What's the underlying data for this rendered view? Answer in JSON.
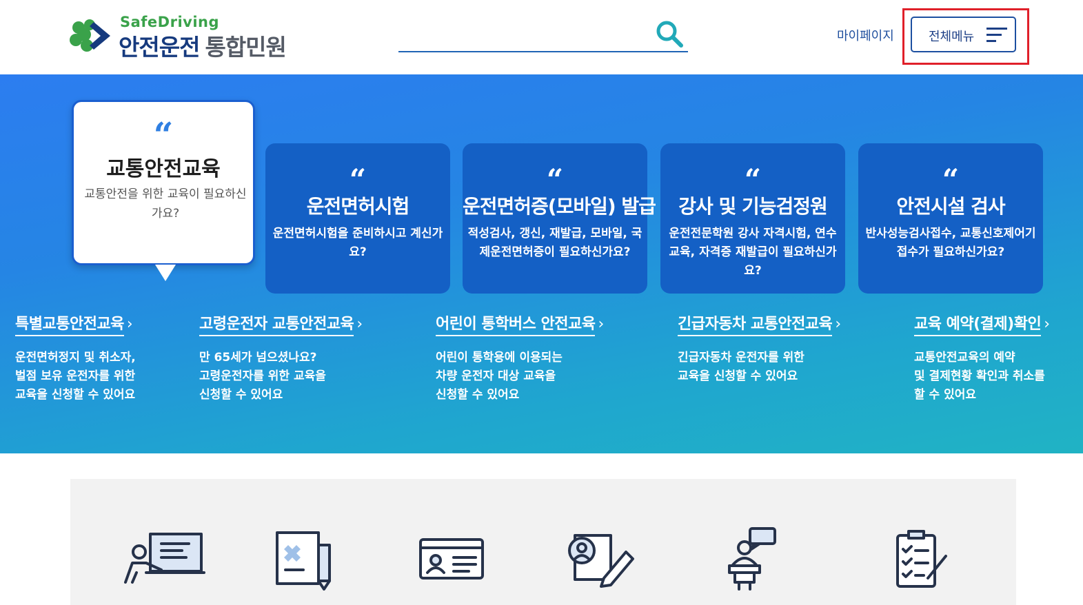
{
  "header": {
    "logo_en": "SafeDriving",
    "logo_ko_main": "안전운전",
    "logo_ko_sub": "통합민원",
    "search_placeholder": "",
    "mypage_label": "마이페이지",
    "menu_label": "전체메뉴"
  },
  "hero": {
    "featured": {
      "quote": "“",
      "title": "교통안전교육",
      "desc": "교통안전을 위한 교육이 필요하신가요?"
    },
    "cards": [
      {
        "quote": "“",
        "title": "운전면허시험",
        "desc": "운전면허시험을 준비하시고 계신가요?"
      },
      {
        "quote": "“",
        "title": "운전면허증(모바일) 발급",
        "desc": "적성검사, 갱신, 재발급, 모바일, 국제운전면허증이 필요하신가요?"
      },
      {
        "quote": "“",
        "title": "강사 및 기능검정원",
        "desc": "운전전문학원 강사 자격시험, 연수교육, 자격증 재발급이 필요하신가요?"
      },
      {
        "quote": "“",
        "title": "안전시설 검사",
        "desc": "반사성능검사접수, 교통신호제어기 접수가 필요하신가요?"
      }
    ],
    "links": [
      {
        "title": "특별교통안전교육",
        "chevron": "›",
        "desc_lines": [
          "운전면허정지 및 취소자,",
          "벌점 보유 운전자를 위한",
          "교육을 신청할 수 있어요"
        ]
      },
      {
        "title": "고령운전자 교통안전교육",
        "chevron": "›",
        "desc_lines": [
          "만 65세가 넘으셨나요?",
          "고령운전자를 위한 교육을",
          "신청할 수 있어요"
        ]
      },
      {
        "title": "어린이 통학버스 안전교육",
        "chevron": "›",
        "desc_lines": [
          "어린이 통학용에 이용되는",
          "차량 운전자 대상 교육을",
          "신청할 수 있어요"
        ]
      },
      {
        "title": "긴급자동차 교통안전교육",
        "chevron": "›",
        "desc_lines": [
          "긴급자동차 운전자를 위한",
          "교육을 신청할 수 있어요"
        ]
      },
      {
        "title": "교육 예약(결제)확인",
        "chevron": "›",
        "desc_lines": [
          "교통안전교육의 예약",
          "및 결제현황 확인과 취소를",
          "할 수 있어요"
        ]
      }
    ]
  },
  "services": [
    {
      "icon": "presentation-icon"
    },
    {
      "icon": "document-pen-icon"
    },
    {
      "icon": "id-card-icon"
    },
    {
      "icon": "profile-edit-icon"
    },
    {
      "icon": "lecturer-icon"
    },
    {
      "icon": "checklist-icon"
    }
  ],
  "colors": {
    "brand_navy": "#163a7e",
    "brand_green": "#3aa24a",
    "card_blue": "#1460c5",
    "highlight_red": "#e0202a"
  }
}
